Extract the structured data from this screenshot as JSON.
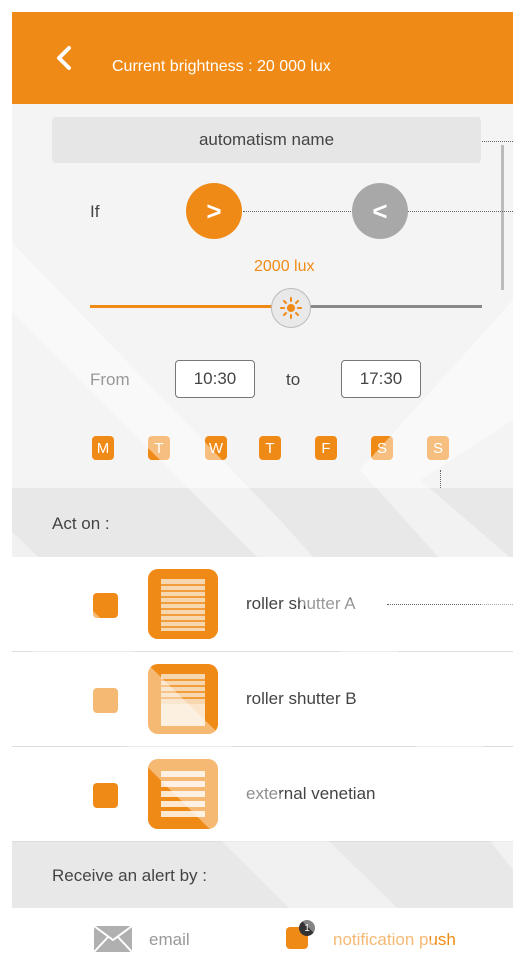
{
  "header": {
    "title": "Current brightness : 20 000 lux"
  },
  "automatism": {
    "name_placeholder": "automatism name"
  },
  "condition": {
    "if_label": "If",
    "greater_label": ">",
    "less_label": "<",
    "selected": ">"
  },
  "threshold": {
    "value_label": "2000 lux",
    "level_percent": 50
  },
  "schedule": {
    "from_label": "From",
    "from_value": "10:30",
    "to_label": "to",
    "to_value": "17:30"
  },
  "days": [
    "M",
    "T",
    "W",
    "T",
    "F",
    "S",
    "S"
  ],
  "act_on": {
    "title": "Act on :",
    "devices": [
      {
        "label": "roller shutter A",
        "icon": "roller-shutter-icon"
      },
      {
        "label": "roller shutter B",
        "icon": "roller-shutter-icon"
      },
      {
        "label": "external venetian",
        "icon": "venetian-blind-icon"
      }
    ]
  },
  "alert": {
    "title": "Receive an alert by :",
    "email_label": "email",
    "push_label": "notification push",
    "push_badge": "1"
  },
  "colors": {
    "accent": "#f08a16",
    "header_text": "#ffffff"
  }
}
